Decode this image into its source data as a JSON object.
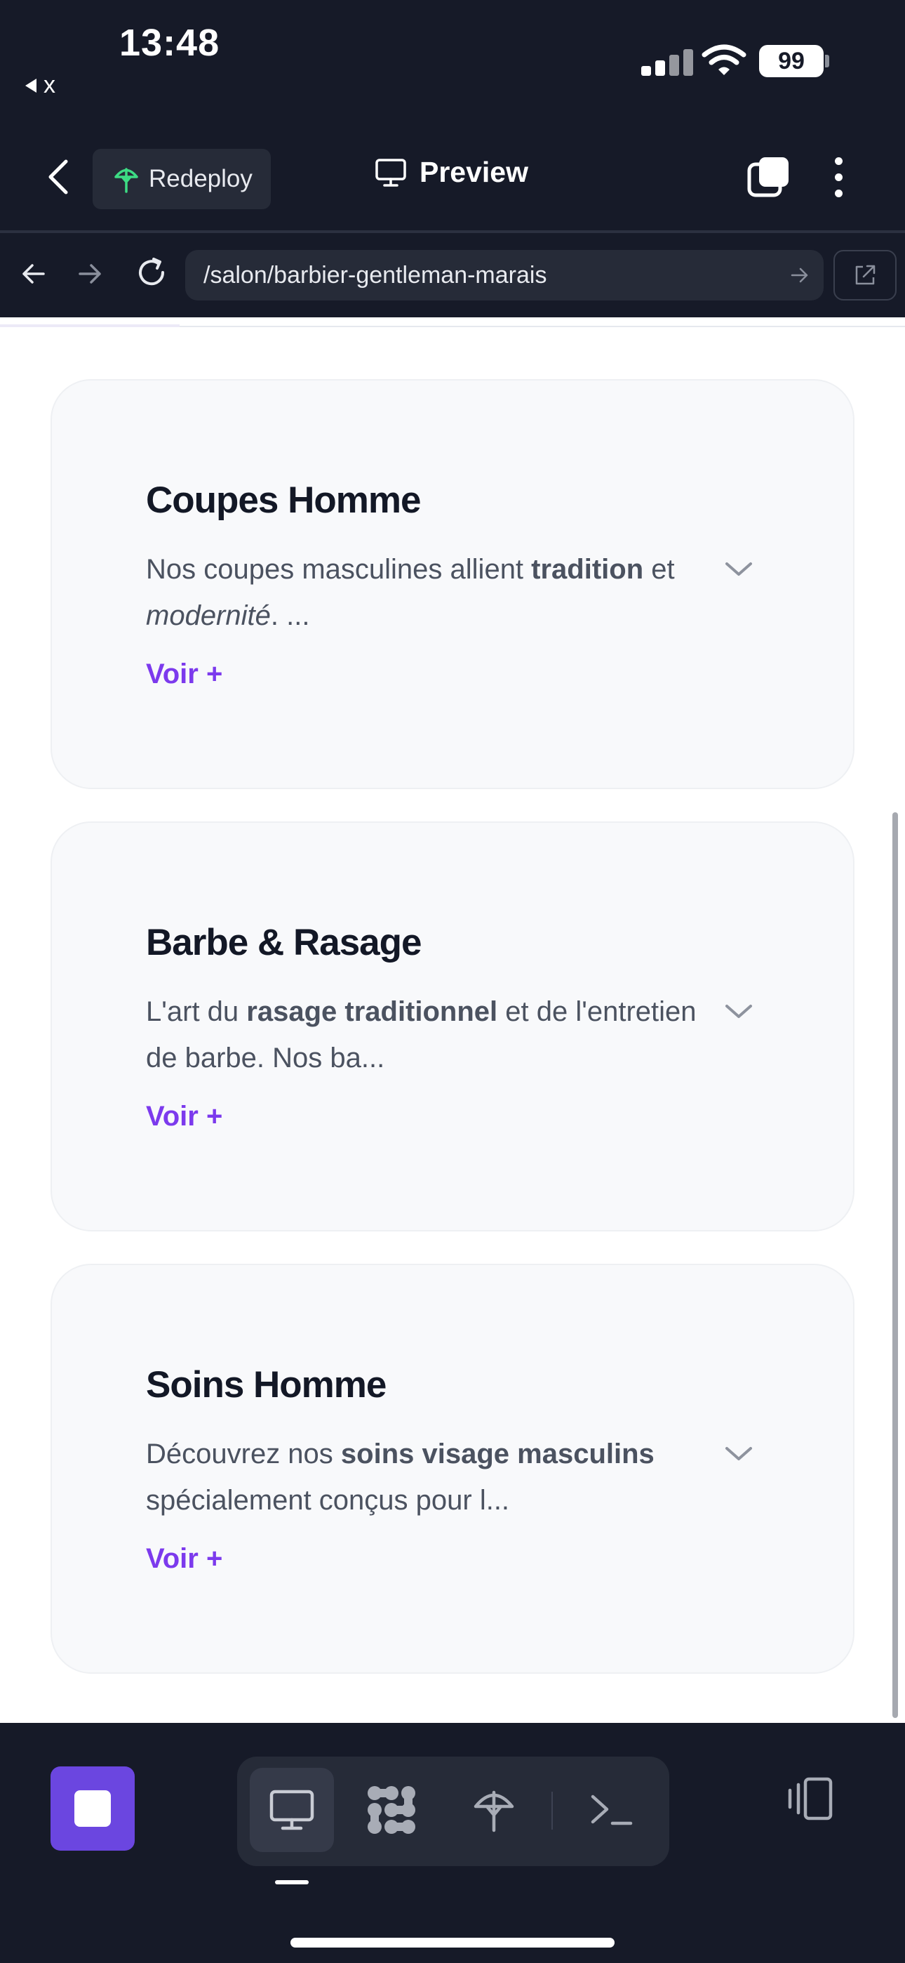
{
  "status_bar": {
    "time": "13:48",
    "back_app_label": "x",
    "battery_level": "99"
  },
  "header": {
    "redeploy_label": "Redeploy",
    "title": "Preview"
  },
  "browser": {
    "url": "/salon/barbier-gentleman-marais"
  },
  "cards": [
    {
      "title": "Coupes Homme",
      "desc_parts": [
        {
          "text": "Nos coupes masculines allient ",
          "style": "normal"
        },
        {
          "text": "tradition",
          "style": "bold"
        },
        {
          "text": " et ",
          "style": "normal"
        },
        {
          "text": "modernité",
          "style": "italic"
        },
        {
          "text": ". ...",
          "style": "normal"
        }
      ],
      "more_label": "Voir +"
    },
    {
      "title": "Barbe & Rasage",
      "desc_parts": [
        {
          "text": "L'art du ",
          "style": "normal"
        },
        {
          "text": "rasage traditionnel",
          "style": "bold"
        },
        {
          "text": " et de l'entretien de barbe. Nos ba...",
          "style": "normal"
        }
      ],
      "more_label": "Voir +"
    },
    {
      "title": "Soins Homme",
      "desc_parts": [
        {
          "text": "Découvrez nos ",
          "style": "normal"
        },
        {
          "text": "soins visage masculins",
          "style": "bold"
        },
        {
          "text": " spécialement conçus pour l...",
          "style": "normal"
        }
      ],
      "more_label": "Voir +"
    }
  ],
  "toolbar": {
    "tools": [
      "desktop-preview-icon",
      "integrations-icon",
      "deploy-icon",
      "terminal-icon"
    ],
    "active_tool": "desktop-preview-icon"
  },
  "colors": {
    "accent": "#7c3aed",
    "stop_button": "#6b46e0",
    "chrome_bg": "#161a28",
    "redeploy_icon": "#3ddc84"
  }
}
